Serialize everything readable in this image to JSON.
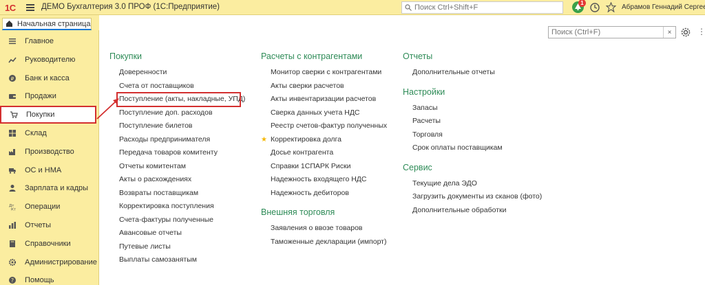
{
  "app": {
    "logo_text": "1С",
    "title": "ДЕМО Бухгалтерия 3.0 ПРОФ  (1С:Предприятие)",
    "search_placeholder": "Поиск Ctrl+Shift+F",
    "notifications_count": "1",
    "user_name": "Абрамов Геннадий Сергеевич"
  },
  "tabs": {
    "home_label": "Начальная страница"
  },
  "sidebar": {
    "items": [
      {
        "label": "Главное",
        "icon": "list-icon"
      },
      {
        "label": "Руководителю",
        "icon": "trend-icon"
      },
      {
        "label": "Банк и касса",
        "icon": "coin-icon"
      },
      {
        "label": "Продажи",
        "icon": "wallet-icon"
      },
      {
        "label": "Покупки",
        "icon": "cart-icon"
      },
      {
        "label": "Склад",
        "icon": "warehouse-icon"
      },
      {
        "label": "Производство",
        "icon": "factory-icon"
      },
      {
        "label": "ОС и НМА",
        "icon": "truck-icon"
      },
      {
        "label": "Зарплата и кадры",
        "icon": "person-icon"
      },
      {
        "label": "Операции",
        "icon": "operations-icon"
      },
      {
        "label": "Отчеты",
        "icon": "bar-chart-icon"
      },
      {
        "label": "Справочники",
        "icon": "book-icon"
      },
      {
        "label": "Администрирование",
        "icon": "gear-icon"
      },
      {
        "label": "Помощь",
        "icon": "help-icon"
      }
    ],
    "active_index": 4
  },
  "main": {
    "search_placeholder": "Поиск (Ctrl+F)",
    "clear_label": "×",
    "columns": [
      {
        "sections": [
          {
            "title": "Покупки",
            "links": [
              "Доверенности",
              "Счета от поставщиков",
              "Поступление (акты, накладные, УПД)",
              "Поступление доп. расходов",
              "Поступление билетов",
              "Расходы предпринимателя",
              "Передача товаров комитенту",
              "Отчеты комитентам",
              "Акты о расхождениях",
              "Возвраты поставщикам",
              "Корректировка поступления",
              "Счета-фактуры полученные",
              "Авансовые отчеты",
              "Путевые листы",
              "Выплаты самозанятым"
            ]
          }
        ]
      },
      {
        "sections": [
          {
            "title": "Расчеты с контрагентами",
            "links": [
              "Монитор сверки с контрагентами",
              "Акты сверки расчетов",
              "Акты инвентаризации расчетов",
              "Сверка данных учета НДС",
              "Реестр счетов-фактур полученных",
              "Корректировка долга",
              "Досье контрагента",
              "Справки 1СПАРК Риски",
              "Надежность входящего НДС",
              "Надежность дебиторов"
            ]
          },
          {
            "title": "Внешняя торговля",
            "links": [
              "Заявления о ввозе товаров",
              "Таможенные декларации (импорт)"
            ]
          }
        ]
      },
      {
        "sections": [
          {
            "title": "Отчеты",
            "links": [
              "Дополнительные отчеты"
            ]
          },
          {
            "title": "Настройки",
            "links": [
              "Запасы",
              "Расчеты",
              "Торговля",
              "Срок оплаты поставщикам"
            ]
          },
          {
            "title": "Сервис",
            "links": [
              "Текущие дела ЭДО",
              "Загрузить документы из сканов (фото)",
              "Дополнительные обработки"
            ]
          }
        ]
      }
    ]
  },
  "colors": {
    "panel_bg": "#fbeda0",
    "section_title": "#2e8b57",
    "highlight": "#d32f2f"
  }
}
